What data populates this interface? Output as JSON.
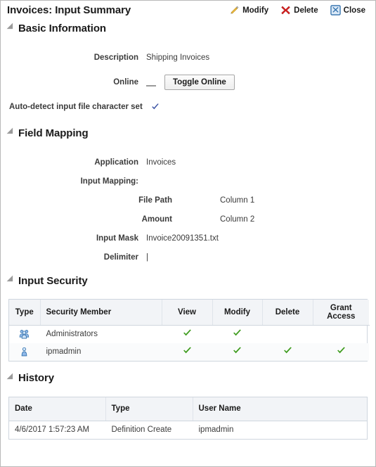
{
  "header": {
    "title": "Invoices: Input Summary",
    "toolbar": [
      {
        "label": "Modify",
        "icon": "pencil-icon"
      },
      {
        "label": "Delete",
        "icon": "red-x-icon"
      },
      {
        "label": "Close",
        "icon": "close-box-icon"
      }
    ]
  },
  "sections": {
    "basic": {
      "title": "Basic Information",
      "description_label": "Description",
      "description_value": "Shipping Invoices",
      "online_label": "Online",
      "online_value": "",
      "toggle_online_button": "Toggle Online",
      "autodetect_label": "Auto-detect input file character set",
      "autodetect_checked": true
    },
    "field_mapping": {
      "title": "Field Mapping",
      "application_label": "Application",
      "application_value": "Invoices",
      "input_mapping_label": "Input Mapping:",
      "mappings": [
        {
          "field": "File Path",
          "column": "Column 1"
        },
        {
          "field": "Amount",
          "column": "Column 2"
        }
      ],
      "input_mask_label": "Input Mask",
      "input_mask_value": "Invoice20091351.txt",
      "delimiter_label": "Delimiter",
      "delimiter_value": "|"
    },
    "input_security": {
      "title": "Input Security",
      "columns": [
        "Type",
        "Security Member",
        "View",
        "Modify",
        "Delete",
        "Grant Access"
      ],
      "rows": [
        {
          "type_icon": "group-icon",
          "member": "Administrators",
          "view": true,
          "modify": true,
          "delete": false,
          "grant_access": false
        },
        {
          "type_icon": "user-icon",
          "member": "ipmadmin",
          "view": true,
          "modify": true,
          "delete": true,
          "grant_access": true
        }
      ]
    },
    "history": {
      "title": "History",
      "columns": [
        "Date",
        "Type",
        "User Name"
      ],
      "rows": [
        {
          "date": "4/6/2017 1:57:23 AM",
          "type": "Definition Create",
          "user": "ipmadmin"
        }
      ]
    }
  },
  "colors": {
    "check_green": "#3f9c1e",
    "check_blue": "#3b53a4",
    "header_bg": "#f2f4f7",
    "border": "#cfd6de",
    "text": "#3b3b3b"
  }
}
